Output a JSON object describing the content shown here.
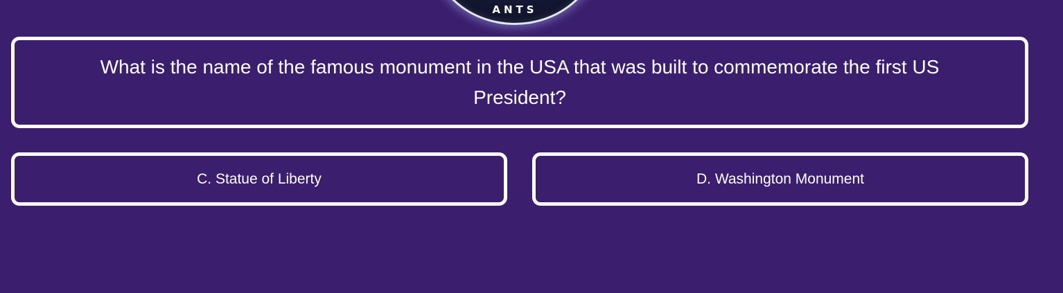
{
  "logo": {
    "ring_text": "ANTS"
  },
  "question": {
    "text": "What is the name of the famous monument in the USA that was built to commemorate the first US President?"
  },
  "answers": [
    {
      "label": "C. Statue of Liberty"
    },
    {
      "label": "D. Washington Monument"
    }
  ],
  "colors": {
    "background": "#3b1f6e",
    "border": "#ffffff",
    "text": "#ffffff"
  }
}
